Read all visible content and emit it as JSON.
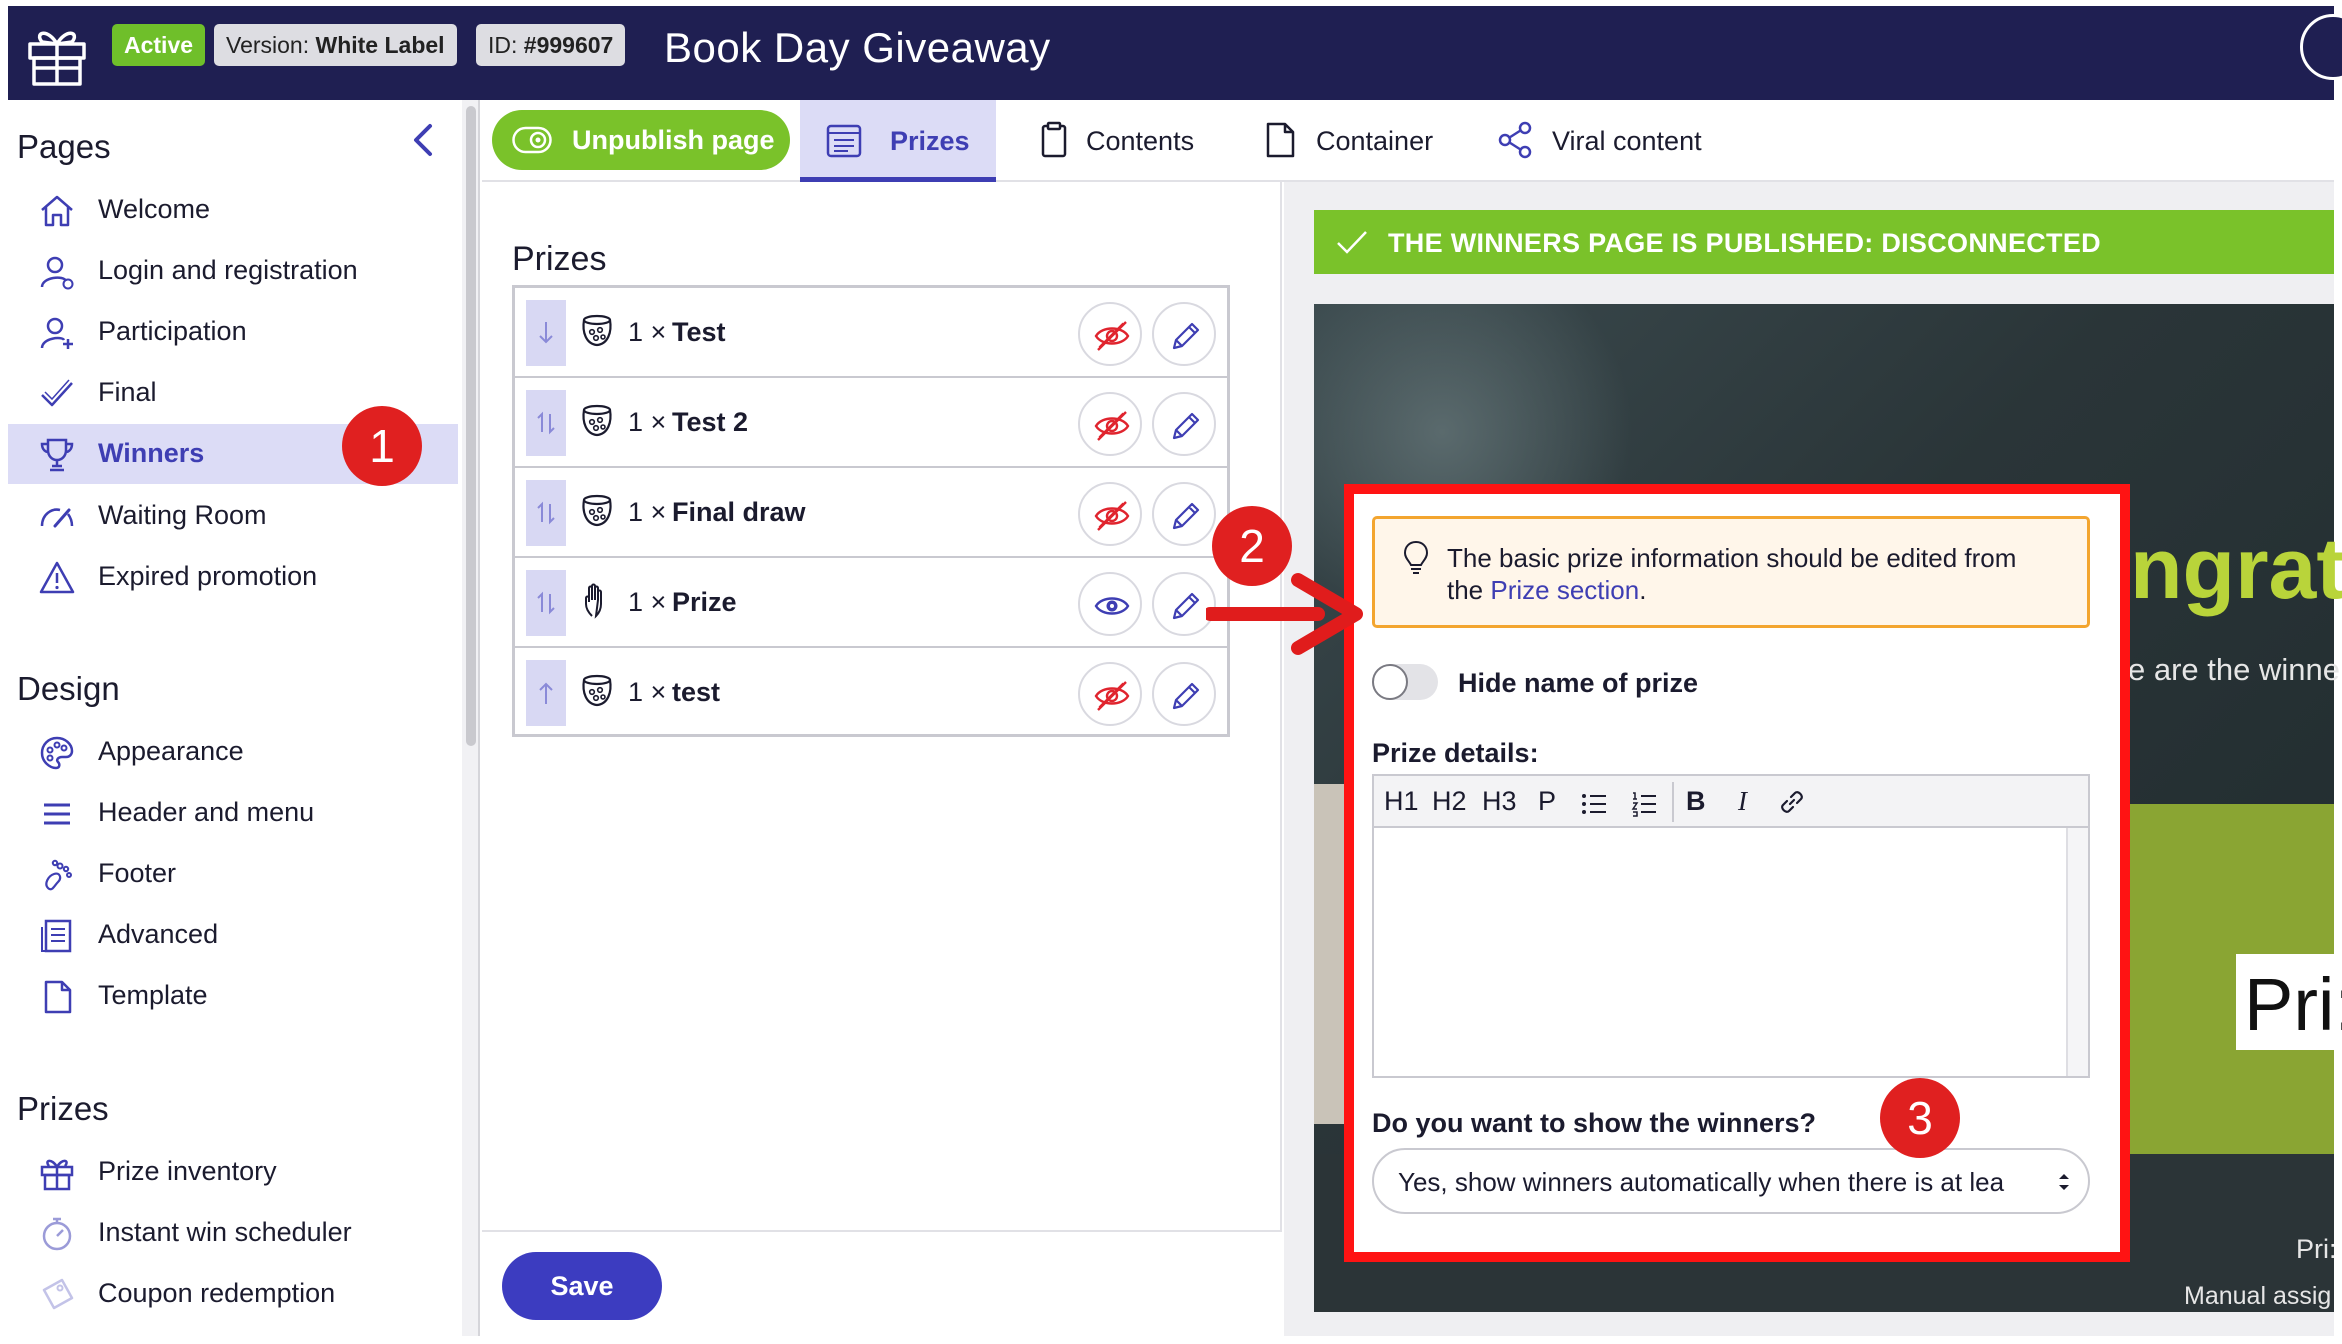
{
  "header": {
    "status_badge": "Active",
    "version_label": "Version:",
    "version_value": "White Label",
    "id_label": "ID:",
    "id_value": "#999607",
    "title": "Book Day Giveaway",
    "colors": {
      "bar": "#1f1f52",
      "active": "#6fbf2a"
    }
  },
  "sidebar": {
    "pages_title": "Pages",
    "pages": [
      {
        "label": "Welcome",
        "icon": "home-icon"
      },
      {
        "label": "Login and registration",
        "icon": "user-login-icon"
      },
      {
        "label": "Participation",
        "icon": "user-add-icon"
      },
      {
        "label": "Final",
        "icon": "checkmark-icon"
      },
      {
        "label": "Winners",
        "icon": "trophy-icon",
        "active": true
      },
      {
        "label": "Waiting Room",
        "icon": "speedometer-icon"
      },
      {
        "label": "Expired promotion",
        "icon": "warning-icon"
      }
    ],
    "design_title": "Design",
    "design": [
      {
        "label": "Appearance",
        "icon": "palette-icon"
      },
      {
        "label": "Header and menu",
        "icon": "menu-icon"
      },
      {
        "label": "Footer",
        "icon": "footprint-icon"
      },
      {
        "label": "Advanced",
        "icon": "document-list-icon"
      },
      {
        "label": "Template",
        "icon": "file-icon"
      }
    ],
    "prizes_title": "Prizes",
    "prizes": [
      {
        "label": "Prize inventory",
        "icon": "gift-icon"
      },
      {
        "label": "Instant win scheduler",
        "icon": "stopwatch-icon"
      },
      {
        "label": "Coupon redemption",
        "icon": "coupon-icon"
      }
    ]
  },
  "tabs": {
    "unpublish_label": "Unpublish page",
    "items": [
      {
        "label": "Prizes",
        "icon": "list-icon",
        "active": true
      },
      {
        "label": "Contents",
        "icon": "clipboard-icon"
      },
      {
        "label": "Container",
        "icon": "file-icon"
      },
      {
        "label": "Viral content",
        "icon": "share-icon"
      }
    ]
  },
  "prizes_panel": {
    "heading": "Prizes",
    "rows": [
      {
        "qty": "1 ×",
        "name": "Test",
        "icon": "cauldron-icon",
        "visible": false,
        "handle": "arrow-down-icon"
      },
      {
        "qty": "1 ×",
        "name": "Test 2",
        "icon": "cauldron-icon",
        "visible": false,
        "handle": "arrow-updown-icon"
      },
      {
        "qty": "1 ×",
        "name": "Final draw",
        "icon": "cauldron-icon",
        "visible": false,
        "handle": "arrow-updown-icon"
      },
      {
        "qty": "1 ×",
        "name": "Prize",
        "icon": "hand-icon",
        "visible": true,
        "handle": "arrow-updown-icon"
      },
      {
        "qty": "1 ×",
        "name": "test",
        "icon": "cauldron-icon",
        "visible": false,
        "handle": "arrow-up-icon"
      }
    ],
    "save_label": "Save"
  },
  "preview": {
    "banner": "THE WINNERS PAGE IS PUBLISHED: DISCONNECTED",
    "congrat_fragment": "ngratu",
    "winners_fragment": "e are the winne",
    "prize_fragment": "Pri:",
    "prize_small_fragment": "Pri:",
    "manual_fragment": "Manual assig"
  },
  "form": {
    "info_text_1": "The basic prize information should be edited from",
    "info_text_2_prefix": "the",
    "info_link": "Prize section",
    "info_text_2_suffix": ".",
    "toggle_label": "Hide name of prize",
    "toggle_on": false,
    "details_label": "Prize details:",
    "editor_tools": [
      "H1",
      "H2",
      "H3",
      "P",
      "B",
      "I"
    ],
    "winners_question": "Do you want to show the winners?",
    "winners_select_value": "Yes, show winners automatically when there is at lea"
  },
  "callouts": [
    "1",
    "2",
    "3"
  ]
}
